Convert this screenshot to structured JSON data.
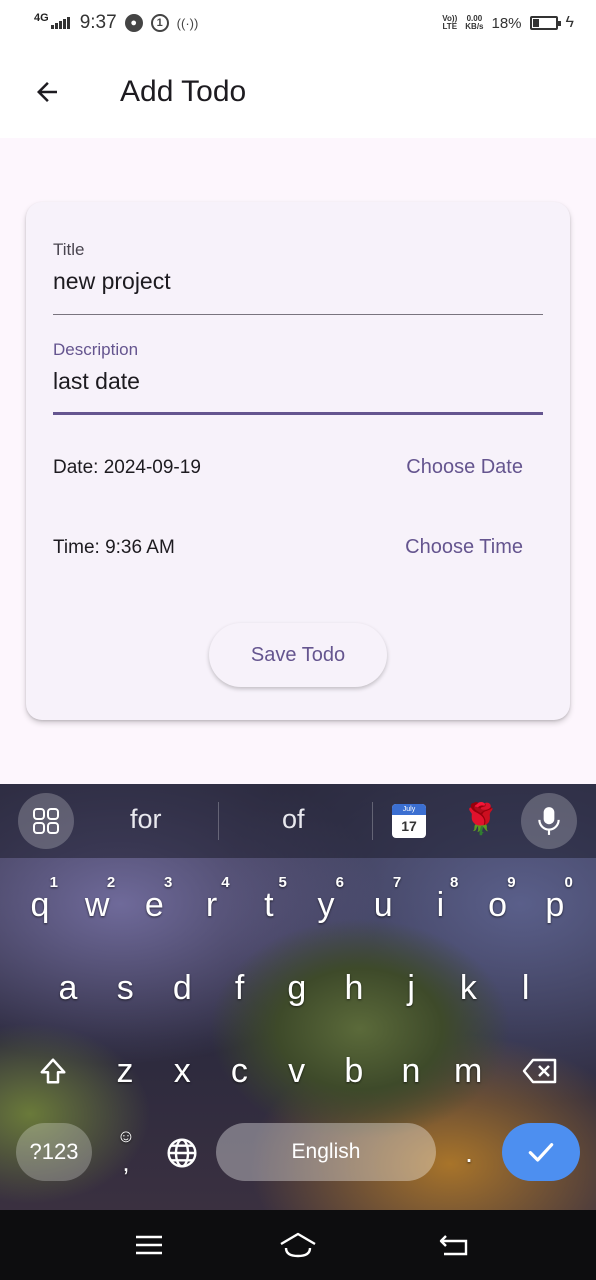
{
  "status_bar": {
    "network": "4G",
    "time": "9:37",
    "volte": "Vo))",
    "lte": "LTE",
    "speed_value": "0.00",
    "speed_unit": "KB/s",
    "battery_pct": "18%",
    "icons": [
      "signal-icon",
      "status-circle-icon",
      "sim-icon",
      "hotspot-icon",
      "battery-icon",
      "charging-icon"
    ]
  },
  "app_bar": {
    "title": "Add Todo",
    "back_icon": "arrow-back-icon"
  },
  "form": {
    "title_field": {
      "label": "Title",
      "value": "new project"
    },
    "description_field": {
      "label": "Description",
      "value": "last date"
    },
    "date_text": "Date: 2024-09-19",
    "choose_date_label": "Choose Date",
    "time_text": "Time: 9:36 AM",
    "choose_time_label": "Choose Time",
    "save_label": "Save Todo"
  },
  "keyboard": {
    "suggestions": [
      "for",
      "of"
    ],
    "calendar_emoji": {
      "month": "July",
      "day": "17"
    },
    "rose_emoji": "🌹",
    "row1": [
      {
        "key": "q",
        "hint": "1"
      },
      {
        "key": "w",
        "hint": "2"
      },
      {
        "key": "e",
        "hint": "3"
      },
      {
        "key": "r",
        "hint": "4"
      },
      {
        "key": "t",
        "hint": "5"
      },
      {
        "key": "y",
        "hint": "6"
      },
      {
        "key": "u",
        "hint": "7"
      },
      {
        "key": "i",
        "hint": "8"
      },
      {
        "key": "o",
        "hint": "9"
      },
      {
        "key": "p",
        "hint": "0"
      }
    ],
    "row2": [
      "a",
      "s",
      "d",
      "f",
      "g",
      "h",
      "j",
      "k",
      "l"
    ],
    "row3": [
      "z",
      "x",
      "c",
      "v",
      "b",
      "n",
      "m"
    ],
    "symbols_label": "?123",
    "comma_label": ",",
    "period_label": ".",
    "space_label": "English",
    "colors": {
      "enter": "#4d8ff0"
    }
  },
  "colors": {
    "primary": "#65558f",
    "surface": "#f7f2fa",
    "background": "#fdf6fd",
    "text": "#1d1b20"
  }
}
